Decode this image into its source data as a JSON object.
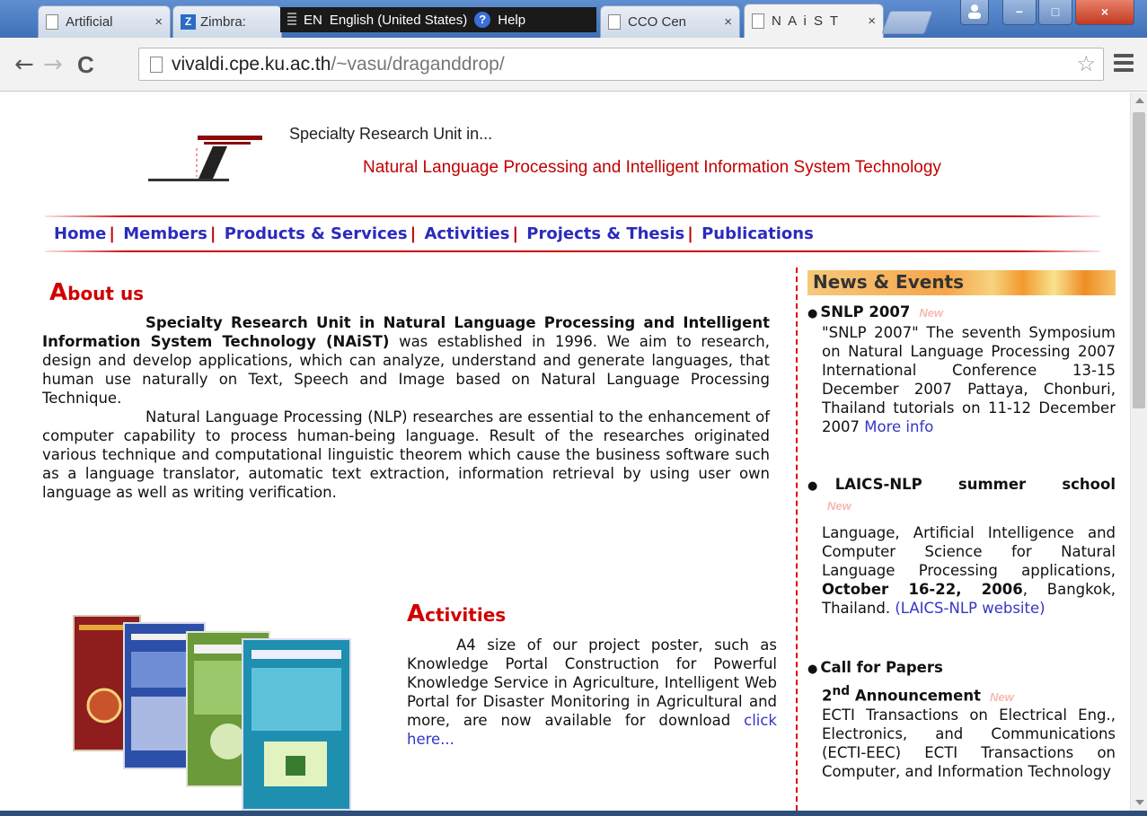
{
  "browser": {
    "tabs": [
      {
        "title": "Artificial",
        "icon": "page-icon",
        "active": false
      },
      {
        "title": "Zimbra:",
        "icon": "zimbra-icon",
        "active": false
      },
      {
        "title": "CCO Cen",
        "icon": "page-icon",
        "active": false
      },
      {
        "title": "N A i S T",
        "icon": "page-icon",
        "active": true
      }
    ],
    "tab_close_glyph": "×",
    "language_bar": {
      "code": "EN",
      "language": "English (United States)",
      "help_label": "Help",
      "help_glyph": "?"
    },
    "zimbra_glyph": "Z",
    "window_controls": {
      "minimize": "−",
      "maximize": "□",
      "close": "×"
    },
    "nav": {
      "back": "←",
      "forward": "→",
      "reload": "C"
    },
    "url_host": "vivaldi.cpe.ku.ac.th",
    "url_path": "/~vasu/draganddrop/",
    "bookmark_glyph": "☆"
  },
  "page": {
    "header": {
      "unit_line": "Specialty Research Unit in...",
      "unit_name": "Natural Language Processing and Intelligent Information System Technology"
    },
    "nav_items": [
      "Home",
      "Members",
      "Products & Services",
      "Activities",
      "Projects & Thesis",
      "Publications"
    ],
    "nav_separator": "|",
    "about": {
      "title_cap": "A",
      "title_rest": "bout us",
      "p1_bold": "Specialty Research Unit in Natural Language Processing and Intelligent Information System Technology (NAiST)",
      "p1_rest": " was established in 1996. We aim to research, design and develop applications, which can analyze, understand and generate languages, that human use naturally on Text, Speech and Image based on Natural Language Processing Technique.",
      "p2": "Natural Language Processing (NLP) researches are essential to the enhancement of computer capability to process human-being language. Result of the researches originated various technique and computational linguistic theorem which cause the business software such as a language translator, automatic text extraction, information retrieval by using user own language as well as writing verification."
    },
    "activities": {
      "title_cap": "A",
      "title_rest": "ctivities",
      "text": "A4 size of our project poster, such as Knowledge Portal Construction for Powerful Knowledge Service in Agriculture, Intelligent Web Portal for Disaster Monitoring in Agricultural and more, are now available for download ",
      "link": "click here..."
    },
    "news": {
      "title": "News & Events",
      "new_badge": "New",
      "bullet": "●",
      "items": [
        {
          "title": "SNLP 2007",
          "body": "\"SNLP 2007\" The seventh Symposium on Natural Language Processing 2007 International Conference 13-15 December 2007 Pattaya, Chonburi, Thailand tutorials on 11-12 December 2007 ",
          "link": "More info"
        },
        {
          "title": "LAICS-NLP summer school",
          "body_a": "Language, Artificial Intelligence and Computer Science for Natural Language Processing applications, ",
          "body_bold": "October 16-22, 2006",
          "body_b": ", Bangkok, Thailand. ",
          "link": "(LAICS-NLP website)"
        },
        {
          "title": "Call for Papers",
          "subtitle_a": "2",
          "subtitle_sup": "nd",
          "subtitle_b": " Announcement",
          "body": "ECTI Transactions on Electrical Eng., Electronics, and Communications (ECTI-EEC) ECTI Transactions on Computer, and Information Technology"
        }
      ]
    }
  }
}
